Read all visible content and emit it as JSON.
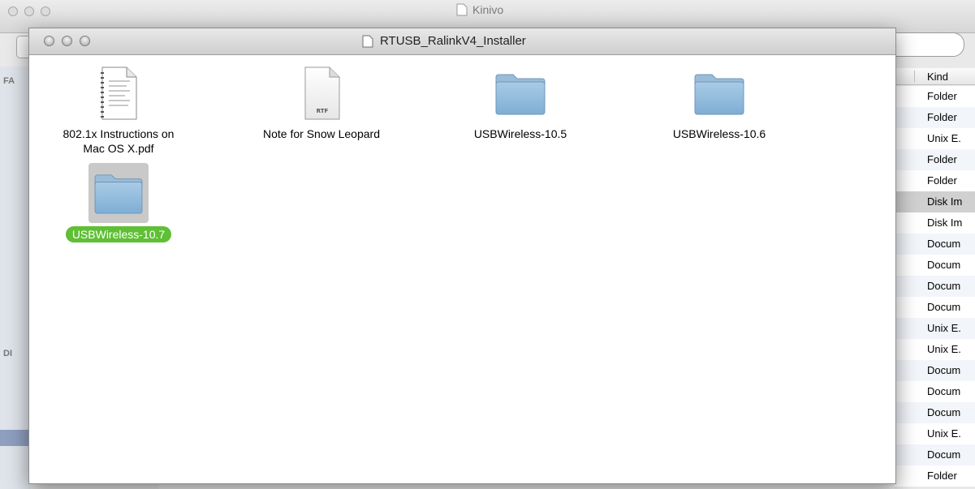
{
  "background_window": {
    "title": "Kinivo",
    "sidebar_labels": [
      "FA",
      "DI"
    ],
    "list_header_kind": "Kind",
    "kind_rows": [
      "Folder",
      "Folder",
      "Unix E.",
      "Folder",
      "Folder",
      "Disk Im",
      "Disk Im",
      "Docum",
      "Docum",
      "Docum",
      "Docum",
      "Unix E.",
      "Unix E.",
      "Docum",
      "Docum",
      "Docum",
      "Unix E.",
      "Docum",
      "Folder"
    ],
    "selected_row_index": 5
  },
  "window": {
    "title": "RTUSB_RalinkV4_Installer",
    "items": [
      {
        "name": "802.1x Instructions on Mac OS X.pdf",
        "line1": "802.1x Instructions on",
        "line2": "Mac OS X.pdf",
        "icon": "pdf-document-icon"
      },
      {
        "name": "Note for Snow Leopard",
        "icon": "rtf-document-icon",
        "badge": "RTF"
      },
      {
        "name": "USBWireless-10.5",
        "icon": "folder-icon"
      },
      {
        "name": "USBWireless-10.6",
        "icon": "folder-icon"
      },
      {
        "name": "USBWireless-10.7",
        "icon": "folder-icon",
        "selected": true
      }
    ]
  },
  "colors": {
    "selection_green": "#5fbf35",
    "folder_blue": "#8fb8d8"
  }
}
